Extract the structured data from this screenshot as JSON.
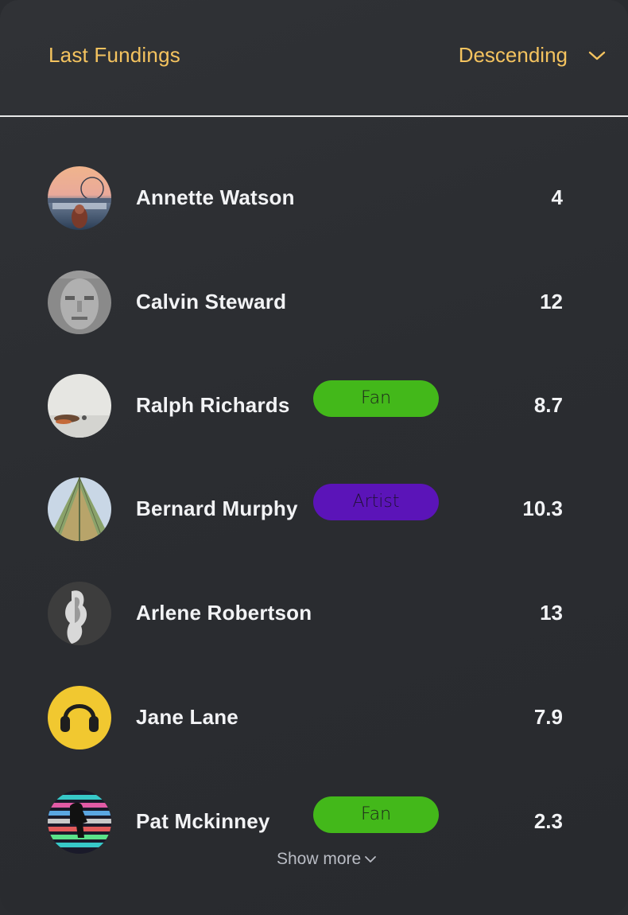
{
  "header": {
    "title": "Last Fundings",
    "sort_label": "Descending",
    "accent_color": "#f4c35f"
  },
  "rows": [
    {
      "name": "Annette Watson",
      "badge": "",
      "value": "4",
      "avatar": "sunset-harbor-portrait"
    },
    {
      "name": "Calvin Steward",
      "badge": "",
      "value": "12",
      "avatar": "grayscale-face"
    },
    {
      "name": "Ralph Richards",
      "badge": "Fan",
      "value": "8.7",
      "avatar": "minimal-table-still-life"
    },
    {
      "name": "Bernard Murphy",
      "badge": "Artist",
      "value": "10.3",
      "avatar": "glass-roof-architecture"
    },
    {
      "name": "Arlene Robertson",
      "badge": "",
      "value": "13",
      "avatar": "silver-sculpture"
    },
    {
      "name": "Jane Lane",
      "badge": "",
      "value": "7.9",
      "avatar": "yellow-headphones"
    },
    {
      "name": "Pat Mckinney",
      "badge": "Fan",
      "value": "2.3",
      "avatar": "neon-stripes-figure"
    }
  ],
  "badge_colors": {
    "Fan": "#43b81a",
    "Artist": "#5b14b8"
  },
  "footer": {
    "show_more_label": "Show more"
  }
}
